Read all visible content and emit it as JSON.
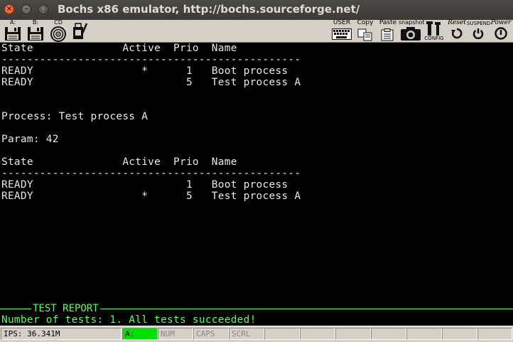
{
  "window": {
    "title": "Bochs x86 emulator, http://bochs.sourceforge.net/",
    "close_glyph": "×",
    "minimize_glyph": "–",
    "maximize_glyph": "□"
  },
  "toolbar": {
    "floppy_a_label": "A:",
    "floppy_b_label": "B:",
    "cdrom_label": "CD",
    "user_label": "USER",
    "copy_label": "Copy",
    "paste_label": "Paste",
    "snapshot_label": "snapshot",
    "config_label": "CONFIG",
    "reset_label": "Reset",
    "suspend_label": "SUSPEND",
    "power_label": "Power"
  },
  "console": {
    "lines": [
      "State              Active  Prio  Name",
      "-----------------------------------------------",
      "READY                 *      1   Boot process",
      "READY                        5   Test process A",
      "",
      "",
      "Process: Test process A",
      "",
      "Param: 42",
      "",
      "State              Active  Prio  Name",
      "-----------------------------------------------",
      "READY                        1   Boot process",
      "READY                 *      5   Test process A"
    ],
    "report_title": "TEST REPORT",
    "report_result": "Number of tests: 1. All tests succeeded!"
  },
  "statusbar": {
    "ips": "IPS: 36.341M",
    "drive": "A:",
    "num": "NUM",
    "caps": "CAPS",
    "scrl": "SCRL"
  },
  "colors": {
    "console_text": "#e8e8e8",
    "report_green": "#55ff55",
    "led_on": "#00e000",
    "toolbar_bg": "#d4d0c8",
    "titlebar_bg": "#3b3a36"
  }
}
